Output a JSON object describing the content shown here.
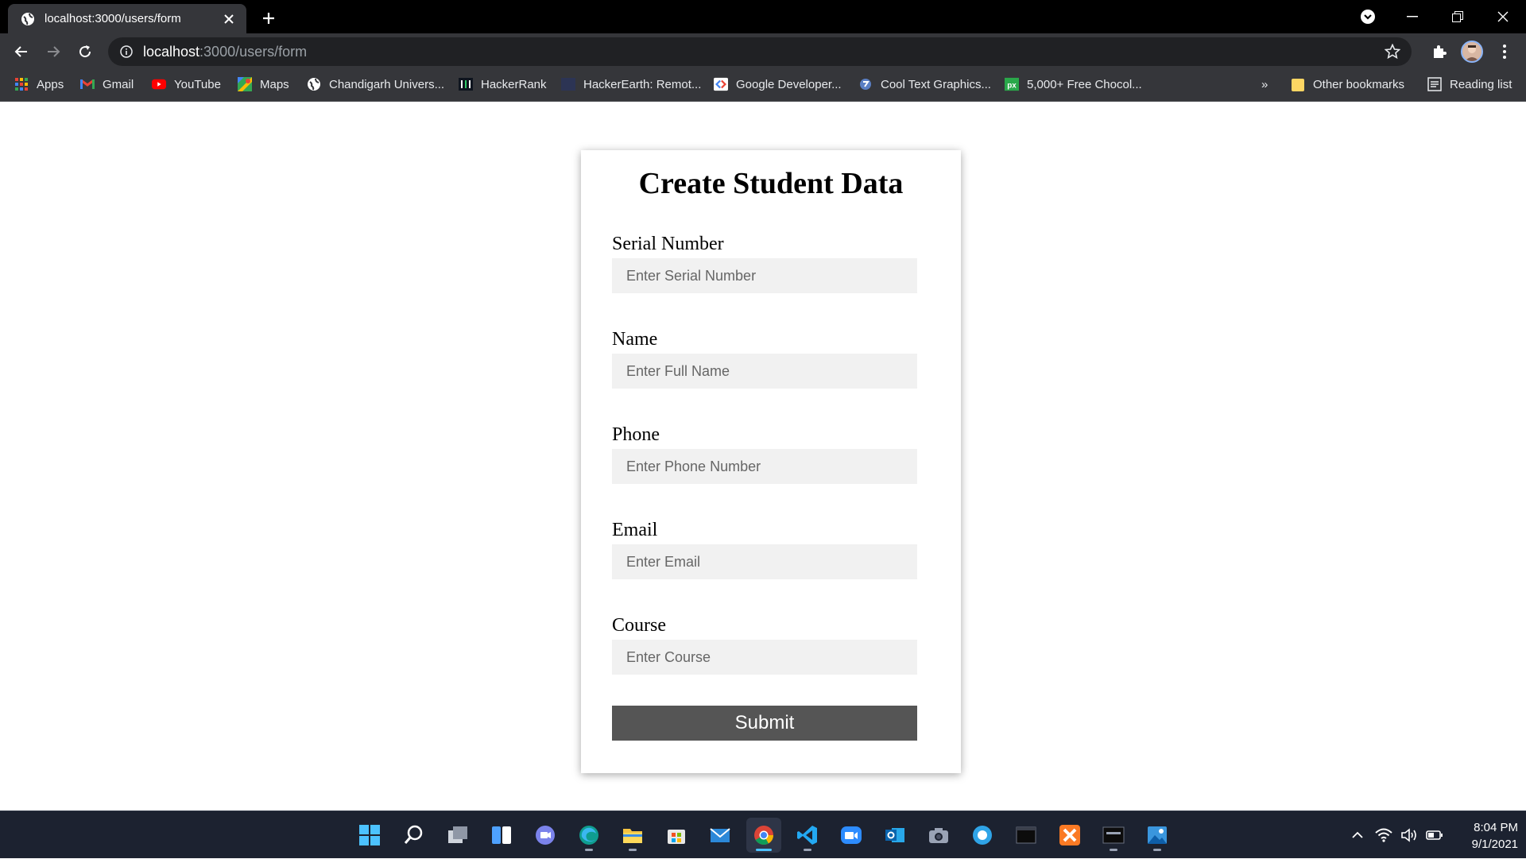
{
  "browser": {
    "tab_title": "localhost:3000/users/form",
    "url_host": "localhost",
    "url_path": ":3000/users/form"
  },
  "bookmarks": {
    "items": [
      {
        "label": "Apps",
        "icon": "apps-grid-icon"
      },
      {
        "label": "Gmail",
        "icon": "gmail-icon"
      },
      {
        "label": "YouTube",
        "icon": "youtube-icon"
      },
      {
        "label": "Maps",
        "icon": "maps-icon"
      },
      {
        "label": "Chandigarh Univers...",
        "icon": "globe-icon"
      },
      {
        "label": "HackerRank",
        "icon": "hackerrank-icon"
      },
      {
        "label": "HackerEarth: Remot...",
        "icon": "hackerearth-icon"
      },
      {
        "label": "Google Developer...",
        "icon": "google-developers-icon"
      },
      {
        "label": "Cool Text Graphics...",
        "icon": "cooltext-icon"
      },
      {
        "label": "5,000+ Free Chocol...",
        "icon": "px-icon"
      }
    ],
    "overflow": "»",
    "other": "Other bookmarks",
    "reading_list": "Reading list"
  },
  "form": {
    "title": "Create Student Data",
    "fields": [
      {
        "label": "Serial Number",
        "placeholder": "Enter Serial Number"
      },
      {
        "label": "Name",
        "placeholder": "Enter Full Name"
      },
      {
        "label": "Phone",
        "placeholder": "Enter Phone Number"
      },
      {
        "label": "Email",
        "placeholder": "Enter Email"
      },
      {
        "label": "Course",
        "placeholder": "Enter Course"
      }
    ],
    "submit_label": "Submit"
  },
  "taskbar": {
    "time": "8:04 PM",
    "date": "9/1/2021",
    "active_app": "chrome"
  },
  "colors": {
    "accent": "#4cc2ff",
    "submit_bg": "#555555",
    "input_bg": "#f1f1f1"
  }
}
